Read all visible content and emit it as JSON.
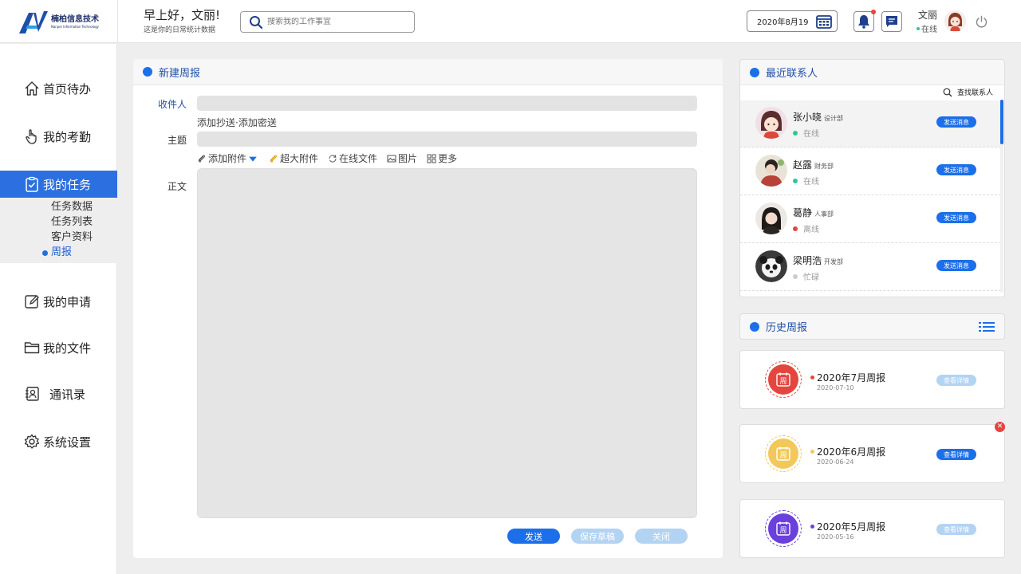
{
  "logo": {
    "name_cn": "楠柏信息技术",
    "name_en": "Nanper Information Technology"
  },
  "header": {
    "greeting": "早上好，文丽!",
    "subtitle": "这是你的日常统计数据",
    "search_placeholder": "搜索我的工作事宜",
    "date": "2020年8月19",
    "user_name": "文丽",
    "user_status": "在线"
  },
  "sidebar": {
    "items": [
      {
        "label": "首页待办",
        "icon": "home-icon"
      },
      {
        "label": "我的考勤",
        "icon": "hand-pointer-icon"
      },
      {
        "label": "我的任务",
        "icon": "task-check-icon"
      },
      {
        "label": "我的申请",
        "icon": "edit-icon"
      },
      {
        "label": "我的文件",
        "icon": "folder-icon"
      },
      {
        "label": "通讯录",
        "icon": "contacts-book-icon"
      },
      {
        "label": "系统设置",
        "icon": "gear-icon"
      }
    ],
    "subitems": [
      "任务数据",
      "任务列表",
      "客户资料",
      "周报"
    ]
  },
  "compose": {
    "title": "新建周报",
    "recipient_label": "收件人",
    "cc_links": "添加抄送·添加密送",
    "subject_label": "主题",
    "attachments": [
      "添加附件",
      "超大附件",
      "在线文件",
      "图片",
      "更多"
    ],
    "body_label": "正文",
    "buttons": {
      "send": "发送",
      "save": "保存草稿",
      "close": "关闭"
    }
  },
  "contacts": {
    "title": "最近联系人",
    "find": "查找联系人",
    "items": [
      {
        "name": "张小晓",
        "dept": "设计部",
        "status": "在线",
        "status_color": "#2fc59a",
        "action": "发送消息"
      },
      {
        "name": "赵露",
        "dept": "财务部",
        "status": "在线",
        "status_color": "#2fc59a",
        "action": "发送消息"
      },
      {
        "name": "葛静",
        "dept": "人事部",
        "status": "离线",
        "status_color": "#e4463f",
        "action": "发送消息"
      },
      {
        "name": "梁明浩",
        "dept": "开发部",
        "status": "忙碌",
        "status_color": "#cccccc",
        "action": "发送消息"
      }
    ]
  },
  "history": {
    "title": "历史周报",
    "badge_text": "周",
    "items": [
      {
        "title": "2020年7月周报",
        "date": "2020-07-10",
        "action": "查看详情",
        "color": "#e4463f",
        "btn_color": "#b3d3f3"
      },
      {
        "title": "2020年6月周报",
        "date": "2020-06-24",
        "action": "查看详情",
        "color": "#f3c85a",
        "btn_color": "#1b6fe8"
      },
      {
        "title": "2020年5月周报",
        "date": "2020-05-16",
        "action": "查看详情",
        "color": "#6a3fdc",
        "btn_color": "#b3d3f3"
      }
    ]
  },
  "colors": {
    "accent": "#1b6fe8",
    "active_nav": "#2c6fe0"
  }
}
